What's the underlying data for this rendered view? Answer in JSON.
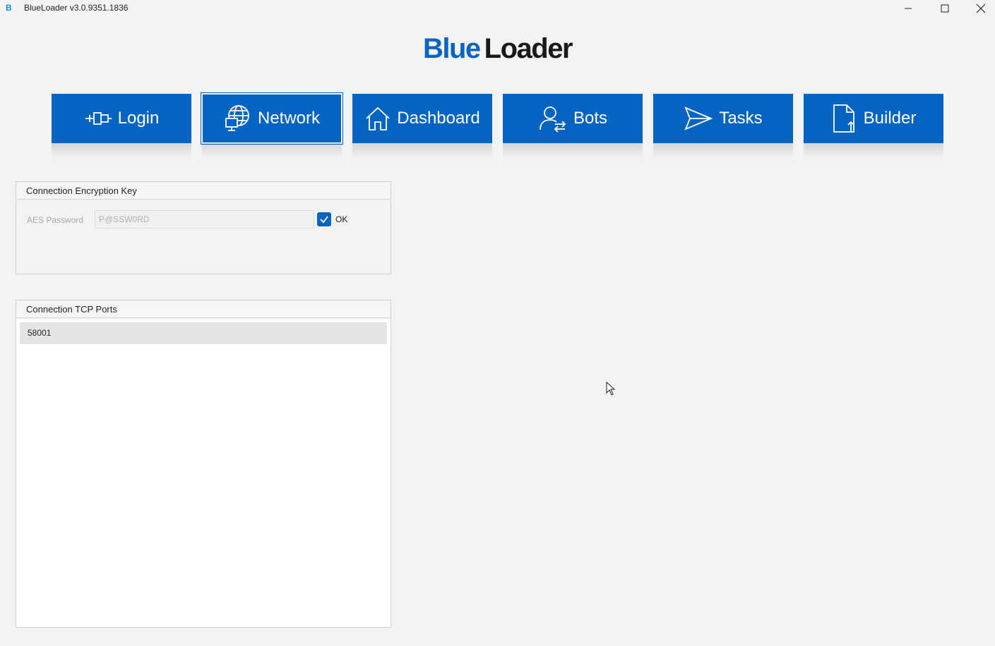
{
  "window": {
    "icon_letter": "B",
    "title": "BlueLoader v3.0.9351.1836"
  },
  "logo": {
    "part1": "Blue",
    "part2": "Loader"
  },
  "nav": [
    {
      "label": "Login",
      "icon": "plug-icon",
      "active": false
    },
    {
      "label": "Network",
      "icon": "globe-monitor-icon",
      "active": true
    },
    {
      "label": "Dashboard",
      "icon": "home-icon",
      "active": false
    },
    {
      "label": "Bots",
      "icon": "user-swap-icon",
      "active": false
    },
    {
      "label": "Tasks",
      "icon": "send-icon",
      "active": false
    },
    {
      "label": "Builder",
      "icon": "file-upload-icon",
      "active": false
    }
  ],
  "encryption": {
    "header": "Connection Encryption Key",
    "aes_label": "AES Password",
    "aes_value": "P@SSW0RD",
    "ok_label": "OK",
    "ok_checked": true
  },
  "ports": {
    "header": "Connection TCP Ports",
    "items": [
      "58001"
    ]
  },
  "colors": {
    "accent": "#0563c1",
    "background": "#f3f3f3"
  }
}
